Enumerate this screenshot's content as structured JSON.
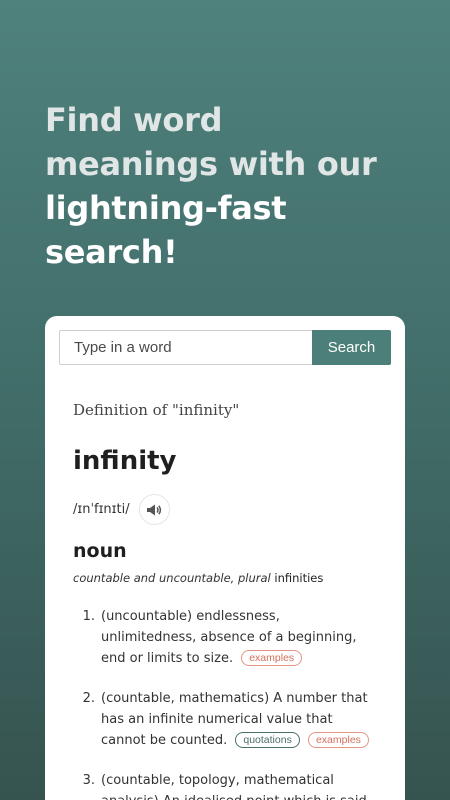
{
  "headline": {
    "part1": "Find word meanings with our ",
    "part2": "lightning-fast search!"
  },
  "search": {
    "placeholder": "Type in a word",
    "button_label": "Search"
  },
  "definition": {
    "heading": "Definition of \"infinity\"",
    "word": "infinity",
    "pronunciation": "/ɪnˈfɪnɪti/",
    "audio_icon": "speaker-icon",
    "part_of_speech": "noun",
    "grammar_italic": "countable and uncountable, plural",
    "grammar_plural": "infinities",
    "senses": [
      {
        "number": "1.",
        "text": "(uncountable) endlessness, unlimitedness, absence of a beginning, end or limits to size.",
        "tags": [
          "examples"
        ]
      },
      {
        "number": "2.",
        "text": "(countable, mathematics) A number that has an infinite numerical value that cannot be counted.",
        "tags": [
          "quotations",
          "examples"
        ]
      },
      {
        "number": "3.",
        "text": "(countable, topology, mathematical analysis) An idealised point which is said",
        "tags": []
      }
    ]
  },
  "colors": {
    "accent": "#4c7f7a",
    "examples_tag": "#d4705c",
    "quotations_tag": "#4a6f6b"
  }
}
